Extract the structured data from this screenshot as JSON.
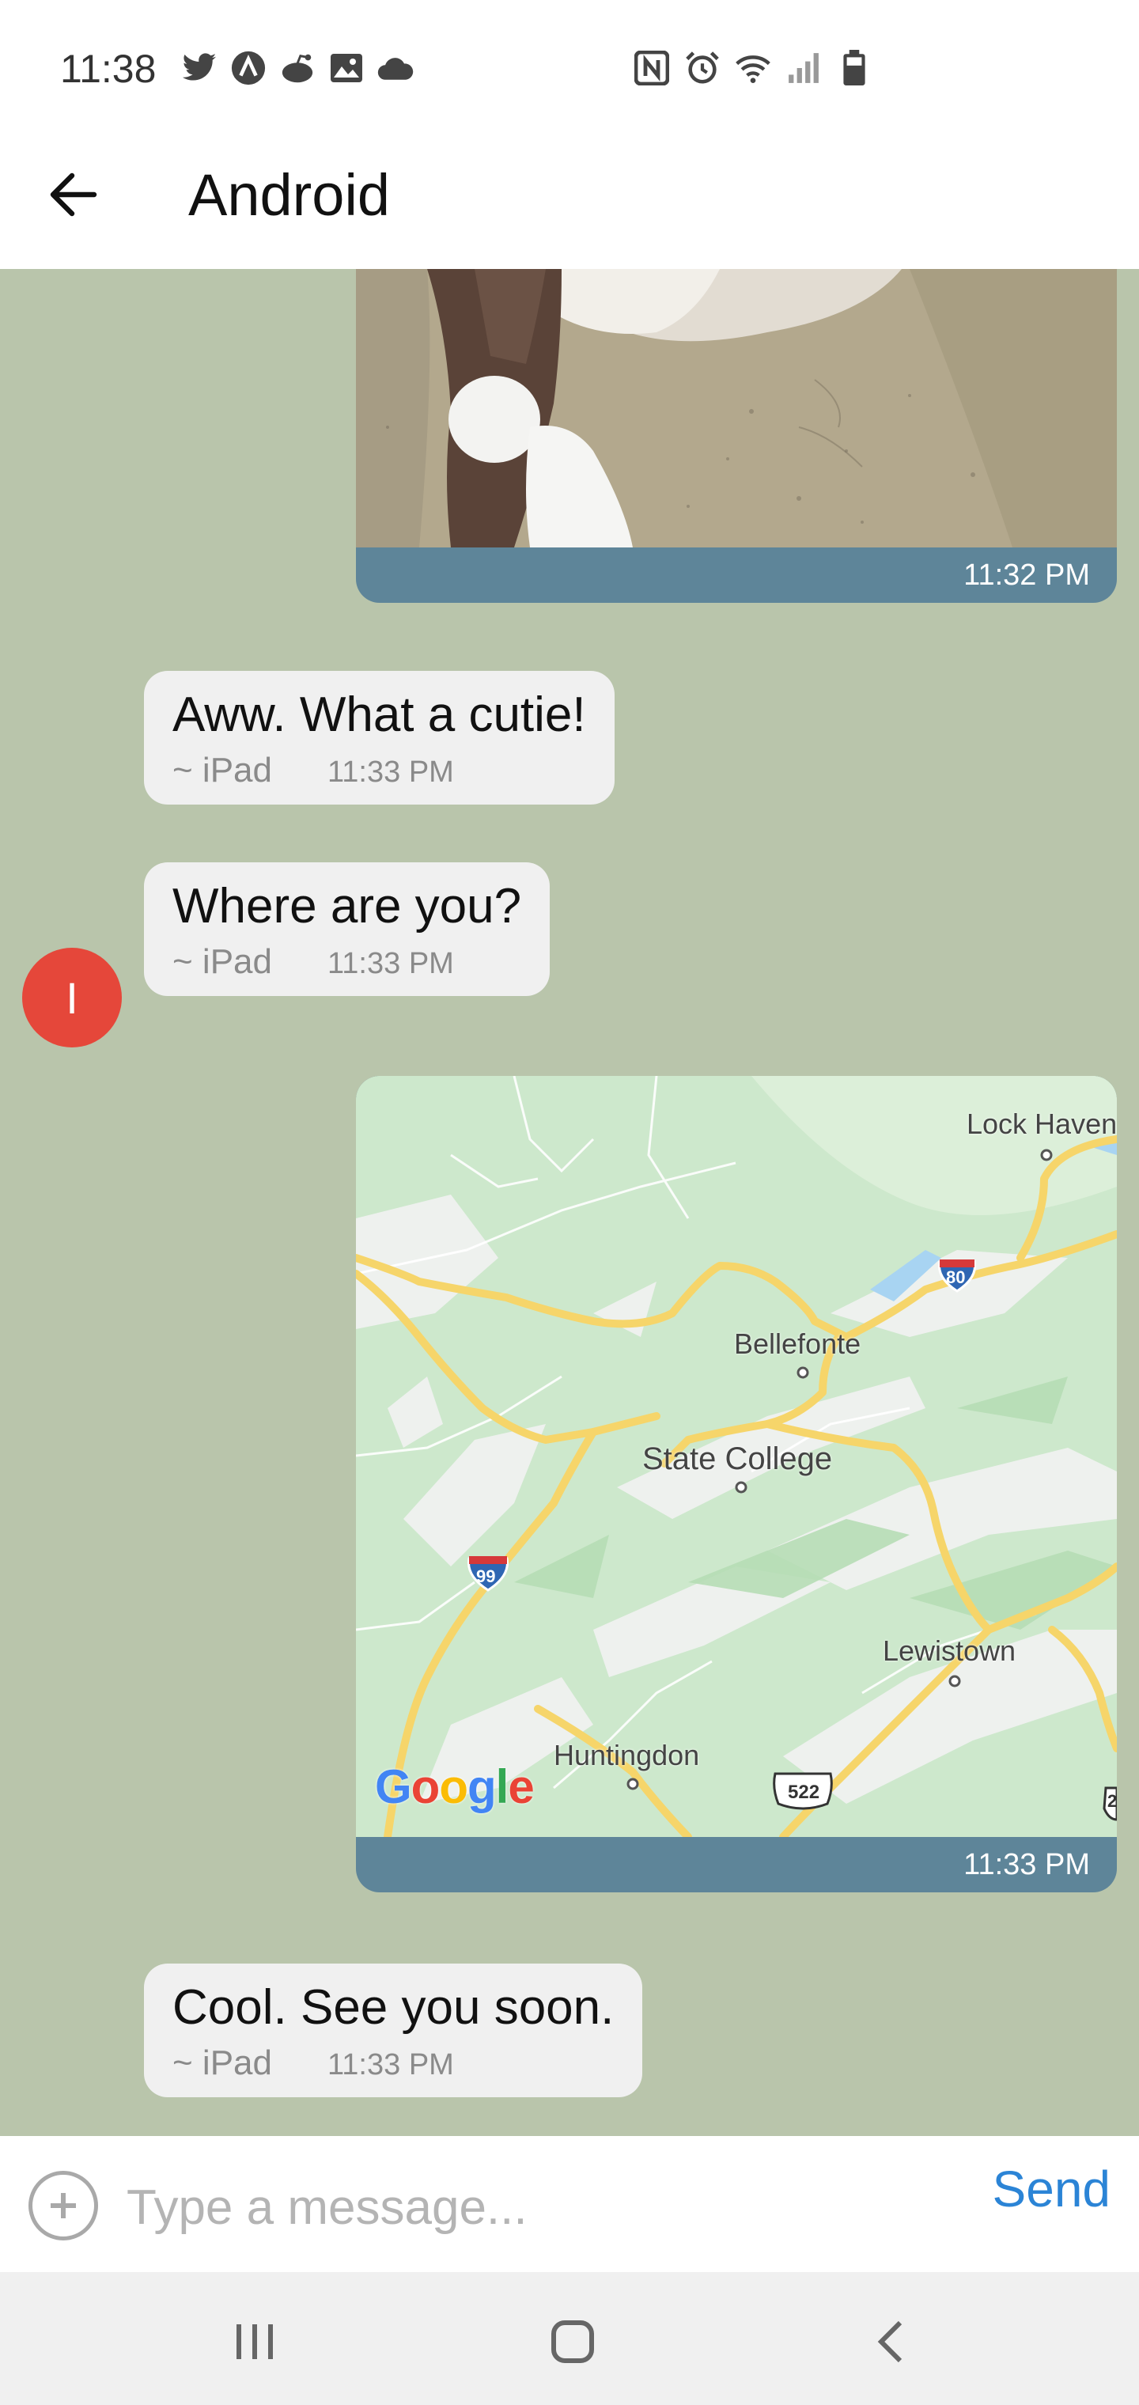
{
  "status_bar": {
    "time": "11:38",
    "left_icons": [
      "twitter-icon",
      "arc-icon",
      "reddit-icon",
      "gallery-icon",
      "cloud-icon"
    ],
    "right_icons": [
      "nfc-icon",
      "alarm-icon",
      "wifi-icon",
      "signal-icon",
      "battery-icon"
    ]
  },
  "app_bar": {
    "title": "Android",
    "back_icon": "arrow-left-icon"
  },
  "messages": [
    {
      "type": "image",
      "side": "right",
      "subject": "cat-photo",
      "time": "11:32 PM"
    },
    {
      "type": "text",
      "side": "left",
      "text": "Aww. What a cutie!",
      "sender": "~ iPad",
      "time": "11:33 PM"
    },
    {
      "type": "text",
      "side": "left",
      "text": "Where are you?",
      "sender": "~ iPad",
      "time": "11:33 PM",
      "avatar_initial": "I"
    },
    {
      "type": "map",
      "side": "right",
      "time": "11:33 PM",
      "places": [
        "Lock Haven",
        "Bellefonte",
        "State College",
        "Lewistown",
        "Huntingdon"
      ],
      "shields": [
        "80",
        "99",
        "522",
        "2"
      ],
      "brand": "Google"
    },
    {
      "type": "text",
      "side": "left",
      "text": "Cool. See you soon.",
      "sender": "~ iPad",
      "time": "11:33 PM"
    }
  ],
  "composer": {
    "placeholder": "Type a message...",
    "send_label": "Send",
    "add_icon": "plus-circle-icon"
  },
  "nav_bar": {
    "icons": [
      "recents-icon",
      "home-icon",
      "back-icon"
    ]
  },
  "colors": {
    "chat_background": "#b9c5ab",
    "image_footer": "#5e8599",
    "bubble": "#f0f0f0",
    "avatar": "#e5473a",
    "send": "#2b84d6"
  }
}
